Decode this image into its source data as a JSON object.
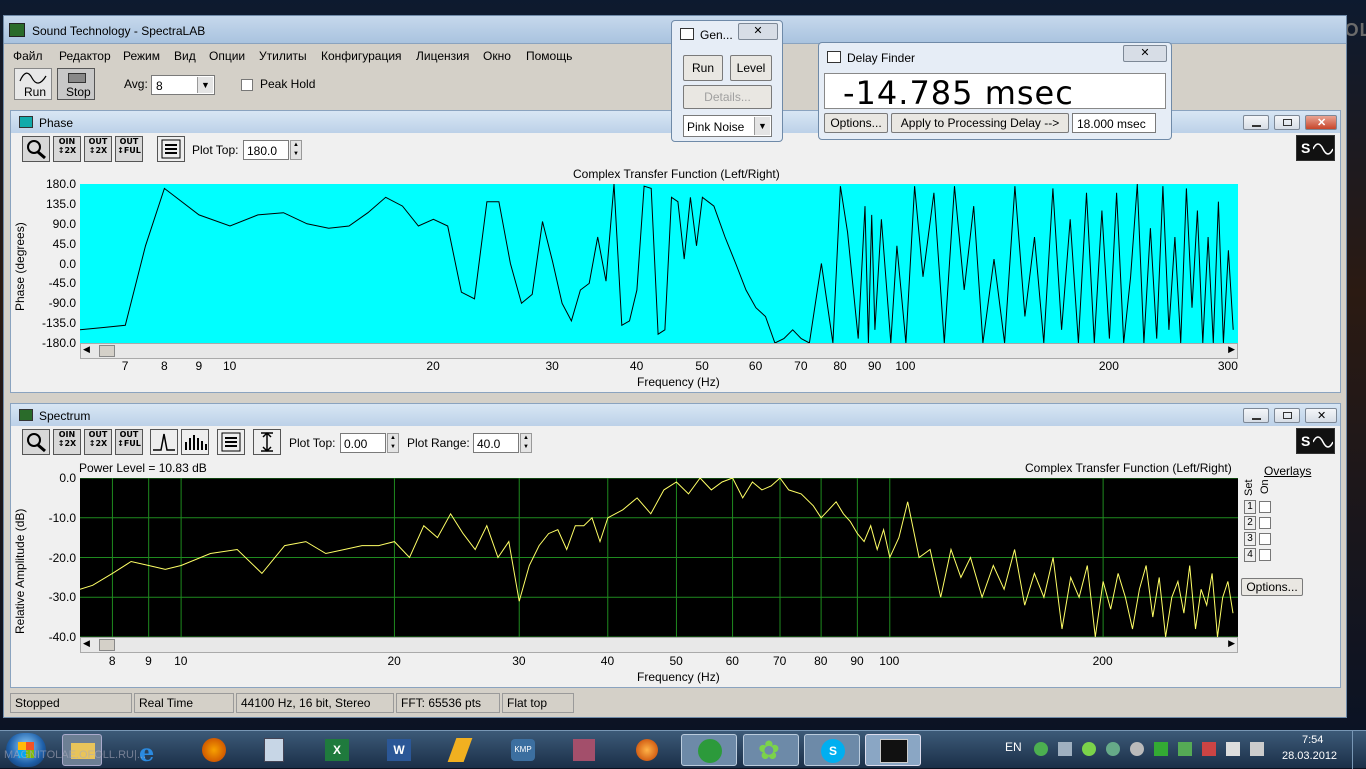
{
  "app": {
    "title": "Sound Technology - SpectraLAB"
  },
  "desktop": {
    "watermark": "MAGNITOLA"
  },
  "menu": [
    "Файл",
    "Редактор",
    "Режим",
    "Вид",
    "Опции",
    "Утилиты",
    "Конфигурация",
    "Лицензия",
    "Окно",
    "Помощь"
  ],
  "toolbar": {
    "run_label": "Run",
    "stop_label": "Stop",
    "avg_label": "Avg:",
    "avg_value": "8",
    "peak_hold_label": "Peak Hold"
  },
  "gen": {
    "title": "Gen...",
    "run_label": "Run",
    "level_label": "Level",
    "details_label": "Details...",
    "signal": "Pink Noise"
  },
  "delay": {
    "title": "Delay Finder",
    "value": "-14.785 msec",
    "options_label": "Options...",
    "apply_label": "Apply to Processing Delay -->",
    "processing_delay": "18.000 msec"
  },
  "phase": {
    "title": "Phase",
    "plot_top_label": "Plot Top:",
    "plot_top_value": "180.0",
    "graph_title": "Complex Transfer Function (Left/Right)",
    "ylabel": "Phase (degrees)",
    "xlabel": "Frequency (Hz)",
    "yticks": [
      "180.0",
      "135.0",
      "90.0",
      "45.0",
      "0.0",
      "-45.0",
      "-90.0",
      "-135.0",
      "-180.0"
    ],
    "xticks": [
      "7",
      "8",
      "9",
      "10",
      "20",
      "30",
      "40",
      "50",
      "60",
      "70",
      "80",
      "90",
      "100",
      "200",
      "300"
    ]
  },
  "spectrum": {
    "title": "Spectrum",
    "plot_top_label": "Plot Top:",
    "plot_top_value": "0.00",
    "plot_range_label": "Plot Range:",
    "plot_range_value": "40.0",
    "power_level": "Power Level = 10.83 dB",
    "graph_title": "Complex Transfer Function (Left/Right)",
    "ylabel": "Relative Amplitude (dB)",
    "xlabel": "Frequency (Hz)",
    "yticks": [
      "0.0",
      "-10.0",
      "-20.0",
      "-30.0",
      "-40.0"
    ],
    "xticks": [
      "8",
      "9",
      "10",
      "20",
      "30",
      "40",
      "50",
      "60",
      "70",
      "80",
      "90",
      "100",
      "200"
    ],
    "overlays_label": "Overlays",
    "set_label": "Set",
    "on_label": "On",
    "overlay_rows": [
      "1",
      "2",
      "3",
      "4"
    ],
    "options_label": "Options..."
  },
  "status": {
    "state": "Stopped",
    "mode": "Real Time",
    "format": "44100 Hz, 16 bit, Stereo",
    "fft": "FFT: 65536 pts",
    "window": "Flat top"
  },
  "taskbar": {
    "lang": "EN",
    "time": "7:54",
    "date": "28.03.2012",
    "watermark": "MAGNITOLAE.OFOLL.RU|..."
  },
  "chart_data": [
    {
      "type": "line",
      "title": "Complex Transfer Function (Left/Right)",
      "xlabel": "Frequency (Hz)",
      "ylabel": "Phase (degrees)",
      "x_scale": "log",
      "xlim": [
        6,
        310
      ],
      "ylim": [
        -180,
        180
      ],
      "grid": false,
      "x": [
        6,
        6.5,
        7,
        7.5,
        8,
        9,
        10,
        11,
        12,
        13,
        14,
        15,
        16,
        17,
        18,
        19,
        20,
        21,
        22,
        23,
        24,
        25,
        26,
        27,
        28,
        29,
        30,
        31,
        32,
        33,
        34,
        35,
        36,
        37,
        38,
        39,
        40,
        41,
        42,
        43,
        44,
        45,
        46,
        47,
        48,
        49,
        50,
        52,
        54,
        56,
        58,
        60,
        62,
        64,
        66,
        68,
        70,
        72,
        75,
        78,
        80,
        82,
        85,
        87,
        88,
        89,
        90,
        92,
        95,
        97,
        100,
        103,
        106,
        110,
        114,
        118,
        122,
        126,
        130,
        135,
        140,
        145,
        150,
        155,
        160,
        165,
        170,
        175,
        180,
        185,
        190,
        195,
        200,
        205,
        210,
        215,
        220,
        225,
        230,
        235,
        240,
        245,
        250,
        255,
        260,
        265,
        270,
        275,
        280,
        285,
        290,
        295,
        300,
        305
      ],
      "values": [
        -150,
        -145,
        -140,
        40,
        170,
        110,
        85,
        110,
        115,
        90,
        80,
        85,
        115,
        150,
        130,
        85,
        100,
        85,
        -65,
        -80,
        140,
        140,
        0,
        -90,
        -70,
        95,
        5,
        -90,
        -130,
        -60,
        -45,
        60,
        -40,
        180,
        -140,
        -130,
        -60,
        175,
        170,
        -160,
        -150,
        150,
        140,
        10,
        150,
        40,
        150,
        130,
        60,
        0,
        -60,
        -100,
        -120,
        -180,
        -170,
        -150,
        -170,
        -180,
        0,
        -180,
        175,
        70,
        -170,
        130,
        -180,
        110,
        -150,
        100,
        -180,
        40,
        -180,
        175,
        -30,
        160,
        -180,
        175,
        -60,
        130,
        -180,
        10,
        -180,
        175,
        -120,
        60,
        -180,
        170,
        -150,
        100,
        -180,
        160,
        -180,
        120,
        -170,
        160,
        -180,
        -30,
        180,
        -180,
        80,
        -170,
        175,
        -150,
        60,
        -180,
        170,
        -100,
        120,
        -180,
        60,
        -180,
        140,
        -180,
        30,
        -150
      ]
    },
    {
      "type": "line",
      "title": "Complex Transfer Function (Left/Right)",
      "xlabel": "Frequency (Hz)",
      "ylabel": "Relative Amplitude (dB)",
      "x_scale": "log",
      "xlim": [
        7.2,
        310
      ],
      "ylim": [
        -40,
        0
      ],
      "grid": true,
      "x": [
        7.2,
        7.5,
        8,
        8.5,
        9,
        9.5,
        10,
        11,
        12,
        13,
        14,
        15,
        16,
        17,
        18,
        19,
        20,
        21,
        22,
        23,
        24,
        25,
        26,
        27,
        28,
        29,
        30,
        31,
        32,
        33,
        34,
        35,
        36,
        37,
        38,
        39,
        40,
        42,
        44,
        46,
        48,
        50,
        52,
        54,
        56,
        58,
        60,
        62,
        64,
        66,
        68,
        70,
        72,
        75,
        78,
        80,
        82,
        84,
        86,
        88,
        90,
        92,
        94,
        96,
        98,
        100,
        103,
        106,
        110,
        114,
        118,
        122,
        126,
        130,
        135,
        140,
        145,
        150,
        155,
        160,
        165,
        170,
        175,
        180,
        185,
        190,
        195,
        200,
        205,
        210,
        215,
        220,
        225,
        230,
        235,
        240,
        245,
        250,
        255,
        260,
        265,
        270,
        275,
        280,
        285,
        290,
        295,
        300,
        305
      ],
      "values": [
        -28,
        -27,
        -24,
        -21,
        -22,
        -23,
        -22,
        -19,
        -18,
        -24,
        -17,
        -16,
        -19,
        -18,
        -17,
        -17,
        -16,
        -20,
        -12,
        -15,
        -9,
        -14,
        -18,
        -12,
        -20,
        -16,
        -31,
        -22,
        -17,
        -14,
        -13,
        -18,
        -12,
        -12,
        -10,
        -16,
        -10,
        -8,
        -5,
        -9,
        -3,
        -1,
        -4,
        0,
        -3,
        -1,
        0,
        -5,
        -1,
        -3,
        -2,
        0,
        -3,
        -4,
        -7,
        -10,
        -8,
        -6,
        -9,
        -11,
        -14,
        -16,
        -12,
        -18,
        -13,
        -20,
        -15,
        -6,
        -20,
        -18,
        -30,
        -18,
        -25,
        -20,
        -30,
        -22,
        -28,
        -18,
        -32,
        -24,
        -30,
        -20,
        -38,
        -25,
        -30,
        -22,
        -40,
        -26,
        -33,
        -24,
        -30,
        -38,
        -28,
        -22,
        -35,
        -25,
        -40,
        -30,
        -26,
        -34,
        -22,
        -38,
        -28,
        -32,
        -24,
        -40,
        -30,
        -26,
        -34
      ]
    }
  ]
}
